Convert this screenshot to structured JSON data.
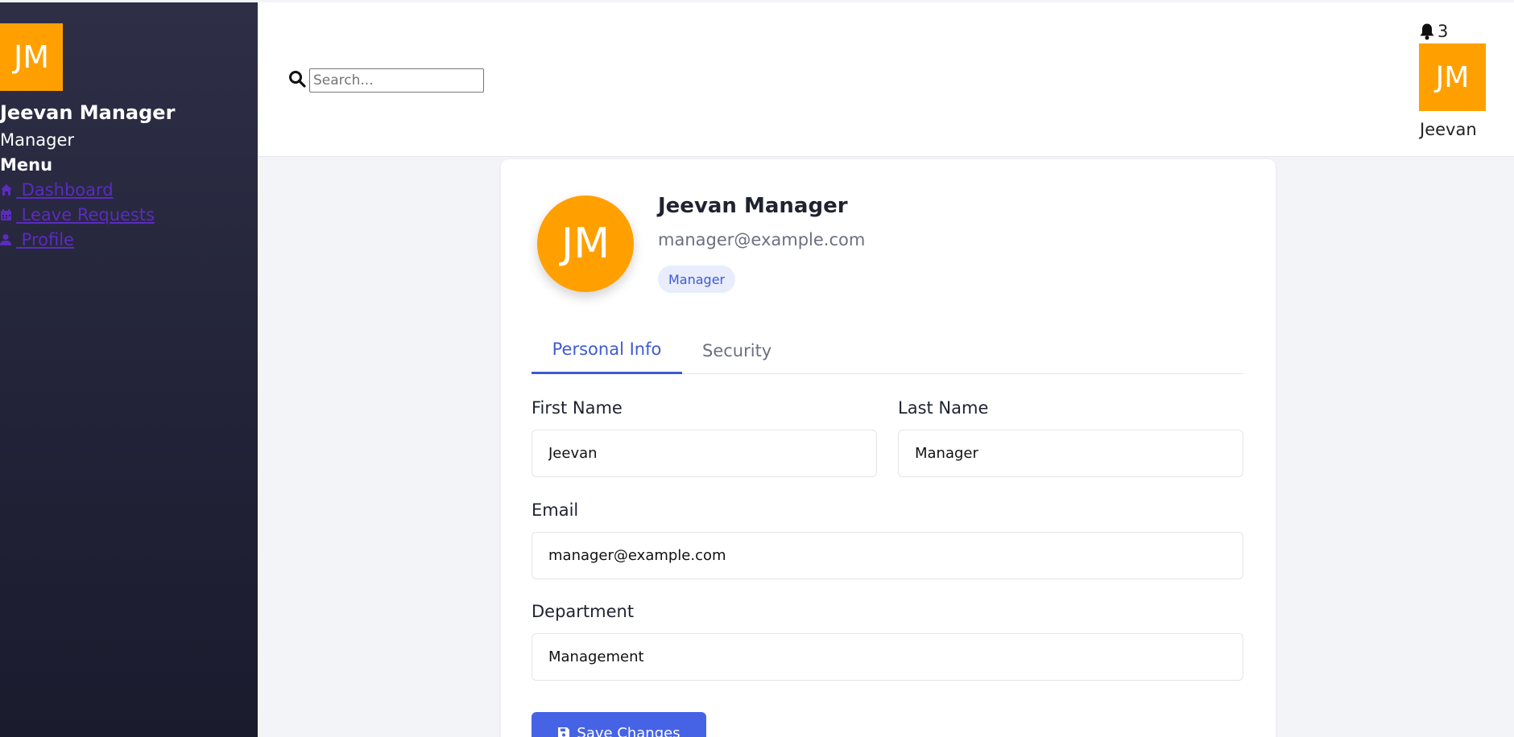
{
  "sidebar": {
    "avatar_initials": "JM",
    "user_name": "Jeevan Manager",
    "user_role": "Manager",
    "menu_title": "Menu",
    "items": [
      {
        "label": " Dashboard",
        "icon": "home-icon"
      },
      {
        "label": " Leave Requests",
        "icon": "calendar-icon"
      },
      {
        "label": " Profile",
        "icon": "user-icon"
      }
    ]
  },
  "header": {
    "search_placeholder": "Search...",
    "notification_count": "3",
    "avatar_initials": "JM",
    "user_first_name": "Jeevan"
  },
  "profile": {
    "avatar_initials": "JM",
    "name": "Jeevan Manager",
    "email": "manager@example.com",
    "role_badge": "Manager"
  },
  "tabs": [
    {
      "label": "Personal Info",
      "active": true
    },
    {
      "label": "Security",
      "active": false
    }
  ],
  "form": {
    "first_name_label": "First Name",
    "first_name_value": "Jeevan",
    "last_name_label": "Last Name",
    "last_name_value": "Manager",
    "email_label": "Email",
    "email_value": "manager@example.com",
    "department_label": "Department",
    "department_value": "Management",
    "save_label": "Save Changes"
  },
  "colors": {
    "avatar": "#ffa000",
    "accent": "#4663e6",
    "sidebar_top": "#2e2f47",
    "sidebar_bottom": "#1b1b2e",
    "link": "#5c2bc0"
  }
}
